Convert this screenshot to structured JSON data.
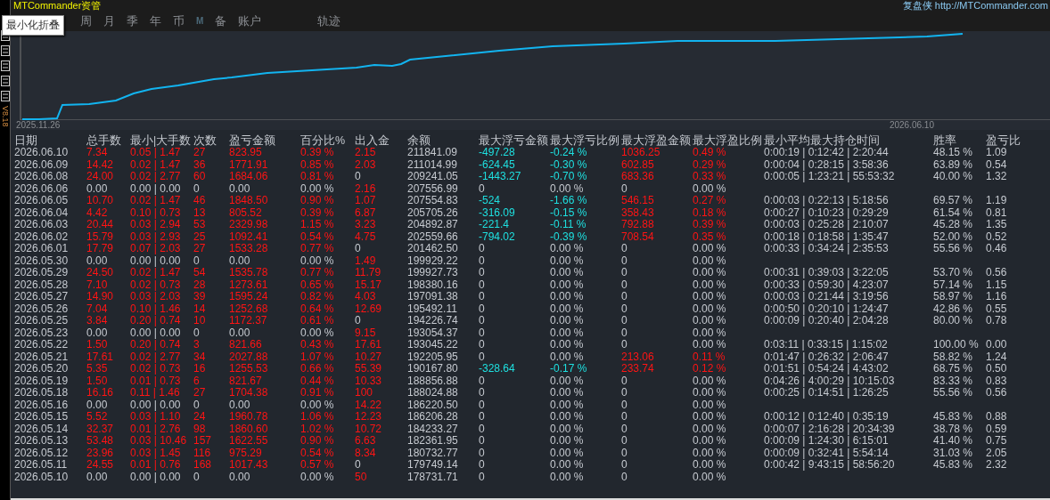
{
  "title": "MTCommander资管",
  "header_link": "复盘侠 http://MTCommander.com",
  "tooltip": "最小化折叠",
  "tabs": [
    "周",
    "月",
    "季",
    "年",
    "币",
    "M",
    "备",
    "账户",
    "轨迹"
  ],
  "version": "V8.18",
  "chart": {
    "start_label": "2025.11.26",
    "end_label": "2026.06.10"
  },
  "table": {
    "columns": [
      "日期",
      "总手数",
      "最小|大手数",
      "次数",
      "盈亏金额",
      "百分比%",
      "出入金",
      "余额",
      "最大浮亏金额",
      "最大浮亏比例",
      "最大浮盈金额",
      "最大浮盈比例",
      "最小平均最大持仓时间",
      "胜率",
      "盈亏比"
    ],
    "rows": [
      {
        "cells": [
          "2026.06.10",
          {
            "text": "7.34",
            "color": "#ff1414"
          },
          {
            "text": "0.05 | 1.47",
            "color": "#ff1414"
          },
          {
            "text": "27",
            "color": "#ff1414"
          },
          {
            "text": "823.95",
            "color": "#ff1414"
          },
          {
            "text": "0.39 %",
            "color": "#ff1414"
          },
          {
            "text": "2.15",
            "color": "#ff1414"
          },
          "211841.09",
          {
            "text": "-497.28",
            "color": "#1ee0e0"
          },
          {
            "text": "-0.24 %",
            "color": "#1ee0e0"
          },
          {
            "text": "1036.25",
            "color": "#ff1414"
          },
          {
            "text": "0.49 %",
            "color": "#ff1414"
          },
          "0:00:19 | 0:12:42 | 2:20:44",
          "48.15 %",
          "1.09"
        ]
      },
      {
        "cells": [
          "2026.06.09",
          {
            "text": "14.42",
            "color": "#ff1414"
          },
          {
            "text": "0.02 | 1.47",
            "color": "#ff1414"
          },
          {
            "text": "36",
            "color": "#ff1414"
          },
          {
            "text": "1771.91",
            "color": "#ff1414"
          },
          {
            "text": "0.85 %",
            "color": "#ff1414"
          },
          {
            "text": "2.03",
            "color": "#ff1414"
          },
          "211014.99",
          {
            "text": "-624.45",
            "color": "#1ee0e0"
          },
          {
            "text": "-0.30 %",
            "color": "#1ee0e0"
          },
          {
            "text": "602.85",
            "color": "#ff1414"
          },
          {
            "text": "0.29 %",
            "color": "#ff1414"
          },
          "0:00:04 | 0:28:15 | 3:58:36",
          "63.89 %",
          "0.54"
        ]
      },
      {
        "cells": [
          "2026.06.08",
          {
            "text": "24.00",
            "color": "#ff1414"
          },
          {
            "text": "0.02 | 2.77",
            "color": "#ff1414"
          },
          {
            "text": "60",
            "color": "#ff1414"
          },
          {
            "text": "1684.06",
            "color": "#ff1414"
          },
          {
            "text": "0.81 %",
            "color": "#ff1414"
          },
          "0",
          "209241.05",
          {
            "text": "-1443.27",
            "color": "#1ee0e0"
          },
          {
            "text": "-0.70 %",
            "color": "#1ee0e0"
          },
          {
            "text": "683.36",
            "color": "#ff1414"
          },
          {
            "text": "0.33 %",
            "color": "#ff1414"
          },
          "0:00:05 | 1:23:21 | 55:53:32",
          "40.00 %",
          "1.32"
        ]
      },
      {
        "cells": [
          "2026.06.06",
          "0.00",
          "0.00 | 0.00",
          "0",
          "0.00",
          "0.00 %",
          {
            "text": "2.16",
            "color": "#ff1414"
          },
          "207556.99",
          "0",
          "0.00 %",
          "0",
          "0.00 %",
          null,
          null,
          null
        ]
      },
      {
        "cells": [
          "2026.06.05",
          {
            "text": "10.70",
            "color": "#ff1414"
          },
          {
            "text": "0.02 | 1.47",
            "color": "#ff1414"
          },
          {
            "text": "46",
            "color": "#ff1414"
          },
          {
            "text": "1848.50",
            "color": "#ff1414"
          },
          {
            "text": "0.90 %",
            "color": "#ff1414"
          },
          {
            "text": "1.07",
            "color": "#ff1414"
          },
          "207554.83",
          {
            "text": "-524",
            "color": "#1ee0e0"
          },
          {
            "text": "-1.66 %",
            "color": "#1ee0e0"
          },
          {
            "text": "546.15",
            "color": "#ff1414"
          },
          {
            "text": "0.27 %",
            "color": "#ff1414"
          },
          "0:00:03 | 0:22:13 | 5:18:56",
          "69.57 %",
          "1.19"
        ]
      },
      {
        "cells": [
          "2026.06.04",
          {
            "text": "4.42",
            "color": "#ff1414"
          },
          {
            "text": "0.10 | 0.73",
            "color": "#ff1414"
          },
          {
            "text": "13",
            "color": "#ff1414"
          },
          {
            "text": "805.52",
            "color": "#ff1414"
          },
          {
            "text": "0.39 %",
            "color": "#ff1414"
          },
          {
            "text": "6.87",
            "color": "#ff1414"
          },
          "205705.26",
          {
            "text": "-316.09",
            "color": "#1ee0e0"
          },
          {
            "text": "-0.15 %",
            "color": "#1ee0e0"
          },
          {
            "text": "358.43",
            "color": "#ff1414"
          },
          {
            "text": "0.18 %",
            "color": "#ff1414"
          },
          "0:00:27 | 0:10:23 | 0:29:29",
          "61.54 %",
          "0.81"
        ]
      },
      {
        "cells": [
          "2026.06.03",
          {
            "text": "20.44",
            "color": "#ff1414"
          },
          {
            "text": "0.03 | 2.94",
            "color": "#ff1414"
          },
          {
            "text": "53",
            "color": "#ff1414"
          },
          {
            "text": "2329.98",
            "color": "#ff1414"
          },
          {
            "text": "1.15 %",
            "color": "#ff1414"
          },
          {
            "text": "3.23",
            "color": "#ff1414"
          },
          "204892.87",
          {
            "text": "-221.4",
            "color": "#1ee0e0"
          },
          {
            "text": "-0.11 %",
            "color": "#1ee0e0"
          },
          {
            "text": "792.88",
            "color": "#ff1414"
          },
          {
            "text": "0.39 %",
            "color": "#ff1414"
          },
          "0:00:03 | 0:25:28 | 2:10:07",
          "45.28 %",
          "1.35"
        ]
      },
      {
        "cells": [
          "2026.06.02",
          {
            "text": "15.79",
            "color": "#ff1414"
          },
          {
            "text": "0.03 | 2.93",
            "color": "#ff1414"
          },
          {
            "text": "25",
            "color": "#ff1414"
          },
          {
            "text": "1092.41",
            "color": "#ff1414"
          },
          {
            "text": "0.54 %",
            "color": "#ff1414"
          },
          {
            "text": "4.75",
            "color": "#ff1414"
          },
          "202559.66",
          {
            "text": "-794.02",
            "color": "#1ee0e0"
          },
          {
            "text": "-0.39 %",
            "color": "#1ee0e0"
          },
          {
            "text": "708.54",
            "color": "#ff1414"
          },
          {
            "text": "0.35 %",
            "color": "#ff1414"
          },
          "0:00:18 | 0:18:58 | 1:35:47",
          "52.00 %",
          "0.52"
        ]
      },
      {
        "cells": [
          "2026.06.01",
          {
            "text": "17.79",
            "color": "#ff1414"
          },
          {
            "text": "0.07 | 2.03",
            "color": "#ff1414"
          },
          {
            "text": "27",
            "color": "#ff1414"
          },
          {
            "text": "1533.28",
            "color": "#ff1414"
          },
          {
            "text": "0.77 %",
            "color": "#ff1414"
          },
          "0",
          "201462.50",
          "0",
          "0.00 %",
          "0",
          "0.00 %",
          "0:00:33 | 0:34:24 | 2:35:53",
          "55.56 %",
          "0.46"
        ]
      },
      {
        "cells": [
          "2026.05.30",
          "0.00",
          "0.00 | 0.00",
          "0",
          "0.00",
          "0.00 %",
          {
            "text": "1.49",
            "color": "#ff1414"
          },
          "199929.22",
          "0",
          "0.00 %",
          "0",
          "0.00 %",
          null,
          null,
          null
        ]
      },
      {
        "cells": [
          "2026.05.29",
          {
            "text": "24.50",
            "color": "#ff1414"
          },
          {
            "text": "0.02 | 1.47",
            "color": "#ff1414"
          },
          {
            "text": "54",
            "color": "#ff1414"
          },
          {
            "text": "1535.78",
            "color": "#ff1414"
          },
          {
            "text": "0.77 %",
            "color": "#ff1414"
          },
          {
            "text": "11.79",
            "color": "#ff1414"
          },
          "199927.73",
          "0",
          "0.00 %",
          "0",
          "0.00 %",
          "0:00:31 | 0:39:03 | 3:22:05",
          "53.70 %",
          "0.56"
        ]
      },
      {
        "cells": [
          "2026.05.28",
          {
            "text": "7.10",
            "color": "#ff1414"
          },
          {
            "text": "0.02 | 0.73",
            "color": "#ff1414"
          },
          {
            "text": "28",
            "color": "#ff1414"
          },
          {
            "text": "1273.61",
            "color": "#ff1414"
          },
          {
            "text": "0.65 %",
            "color": "#ff1414"
          },
          {
            "text": "15.17",
            "color": "#ff1414"
          },
          "198380.16",
          "0",
          "0.00 %",
          "0",
          "0.00 %",
          "0:00:33 | 0:59:30 | 4:23:07",
          "57.14 %",
          "1.15"
        ]
      },
      {
        "cells": [
          "2026.05.27",
          {
            "text": "14.90",
            "color": "#ff1414"
          },
          {
            "text": "0.03 | 2.03",
            "color": "#ff1414"
          },
          {
            "text": "39",
            "color": "#ff1414"
          },
          {
            "text": "1595.24",
            "color": "#ff1414"
          },
          {
            "text": "0.82 %",
            "color": "#ff1414"
          },
          {
            "text": "4.03",
            "color": "#ff1414"
          },
          "197091.38",
          "0",
          "0.00 %",
          "0",
          "0.00 %",
          "0:00:03 | 0:21:44 | 3:19:56",
          "58.97 %",
          "1.16"
        ]
      },
      {
        "cells": [
          "2026.05.26",
          {
            "text": "7.04",
            "color": "#ff1414"
          },
          {
            "text": "0.10 | 1.46",
            "color": "#ff1414"
          },
          {
            "text": "14",
            "color": "#ff1414"
          },
          {
            "text": "1252.68",
            "color": "#ff1414"
          },
          {
            "text": "0.64 %",
            "color": "#ff1414"
          },
          {
            "text": "12.69",
            "color": "#ff1414"
          },
          "195492.11",
          "0",
          "0.00 %",
          "0",
          "0.00 %",
          "0:00:50 | 0:20:10 | 1:24:47",
          "42.86 %",
          "0.55"
        ]
      },
      {
        "cells": [
          "2026.05.25",
          {
            "text": "3.84",
            "color": "#ff1414"
          },
          {
            "text": "0.20 | 0.74",
            "color": "#ff1414"
          },
          {
            "text": "10",
            "color": "#ff1414"
          },
          {
            "text": "1172.37",
            "color": "#ff1414"
          },
          {
            "text": "0.61 %",
            "color": "#ff1414"
          },
          "0",
          "194226.74",
          "0",
          "0.00 %",
          "0",
          "0.00 %",
          "0:00:09 | 0:20:40 | 2:04:28",
          "80.00 %",
          "0.78"
        ]
      },
      {
        "cells": [
          "2026.05.23",
          "0.00",
          "0.00 | 0.00",
          "0",
          "0.00",
          "0.00 %",
          {
            "text": "9.15",
            "color": "#ff1414"
          },
          "193054.37",
          "0",
          "0.00 %",
          "0",
          "0.00 %",
          null,
          null,
          null
        ]
      },
      {
        "cells": [
          "2026.05.22",
          {
            "text": "1.50",
            "color": "#ff1414"
          },
          {
            "text": "0.20 | 0.74",
            "color": "#ff1414"
          },
          {
            "text": "3",
            "color": "#ff1414"
          },
          {
            "text": "821.66",
            "color": "#ff1414"
          },
          {
            "text": "0.43 %",
            "color": "#ff1414"
          },
          {
            "text": "17.61",
            "color": "#ff1414"
          },
          "193045.22",
          "0",
          "0.00 %",
          "0",
          "0.00 %",
          "0:03:11 | 0:33:15 | 1:15:02",
          "100.00 %",
          "0.00"
        ]
      },
      {
        "cells": [
          "2026.05.21",
          {
            "text": "17.61",
            "color": "#ff1414"
          },
          {
            "text": "0.02 | 2.77",
            "color": "#ff1414"
          },
          {
            "text": "34",
            "color": "#ff1414"
          },
          {
            "text": "2027.88",
            "color": "#ff1414"
          },
          {
            "text": "1.07 %",
            "color": "#ff1414"
          },
          {
            "text": "10.27",
            "color": "#ff1414"
          },
          "192205.95",
          "0",
          "0.00 %",
          {
            "text": "213.06",
            "color": "#ff1414"
          },
          {
            "text": "0.11 %",
            "color": "#ff1414"
          },
          "0:01:47 | 0:26:32 | 2:06:47",
          "58.82 %",
          "1.24"
        ]
      },
      {
        "cells": [
          "2026.05.20",
          {
            "text": "5.35",
            "color": "#ff1414"
          },
          {
            "text": "0.02 | 0.73",
            "color": "#ff1414"
          },
          {
            "text": "16",
            "color": "#ff1414"
          },
          {
            "text": "1255.53",
            "color": "#ff1414"
          },
          {
            "text": "0.66 %",
            "color": "#ff1414"
          },
          {
            "text": "55.39",
            "color": "#ff1414"
          },
          "190167.80",
          {
            "text": "-328.64",
            "color": "#1ee0e0"
          },
          {
            "text": "-0.17 %",
            "color": "#1ee0e0"
          },
          {
            "text": "233.74",
            "color": "#ff1414"
          },
          {
            "text": "0.12 %",
            "color": "#ff1414"
          },
          "0:01:51 | 0:54:24 | 4:43:02",
          "68.75 %",
          "0.50"
        ]
      },
      {
        "cells": [
          "2026.05.19",
          {
            "text": "1.50",
            "color": "#ff1414"
          },
          {
            "text": "0.01 | 0.73",
            "color": "#ff1414"
          },
          {
            "text": "6",
            "color": "#ff1414"
          },
          {
            "text": "821.67",
            "color": "#ff1414"
          },
          {
            "text": "0.44 %",
            "color": "#ff1414"
          },
          {
            "text": "10.33",
            "color": "#ff1414"
          },
          "188856.88",
          "0",
          "0.00 %",
          "0",
          "0.00 %",
          "0:04:26 | 4:00:29 | 10:15:03",
          "83.33 %",
          "0.83"
        ]
      },
      {
        "cells": [
          "2026.05.18",
          {
            "text": "16.16",
            "color": "#ff1414"
          },
          {
            "text": "0.11 | 1.46",
            "color": "#ff1414"
          },
          {
            "text": "27",
            "color": "#ff1414"
          },
          {
            "text": "1704.38",
            "color": "#ff1414"
          },
          {
            "text": "0.91 %",
            "color": "#ff1414"
          },
          {
            "text": "100",
            "color": "#ff1414"
          },
          "188024.88",
          "0",
          "0.00 %",
          "0",
          "0.00 %",
          "0:00:25 | 0:14:51 | 1:26:25",
          "55.56 %",
          "0.56"
        ]
      },
      {
        "cells": [
          "2026.05.16",
          "0.00",
          "0.00 | 0.00",
          "0",
          "0.00",
          "0.00 %",
          {
            "text": "14.22",
            "color": "#ff1414"
          },
          "186220.50",
          "0",
          "0.00 %",
          "0",
          "0.00 %",
          null,
          null,
          null
        ]
      },
      {
        "cells": [
          "2026.05.15",
          {
            "text": "5.52",
            "color": "#ff1414"
          },
          {
            "text": "0.03 | 1.10",
            "color": "#ff1414"
          },
          {
            "text": "24",
            "color": "#ff1414"
          },
          {
            "text": "1960.78",
            "color": "#ff1414"
          },
          {
            "text": "1.06 %",
            "color": "#ff1414"
          },
          {
            "text": "12.23",
            "color": "#ff1414"
          },
          "186206.28",
          "0",
          "0.00 %",
          "0",
          "0.00 %",
          "0:00:12 | 0:12:40 | 0:35:19",
          "45.83 %",
          "0.88"
        ]
      },
      {
        "cells": [
          "2026.05.14",
          {
            "text": "32.37",
            "color": "#ff1414"
          },
          {
            "text": "0.01 | 2.76",
            "color": "#ff1414"
          },
          {
            "text": "98",
            "color": "#ff1414"
          },
          {
            "text": "1860.60",
            "color": "#ff1414"
          },
          {
            "text": "1.02 %",
            "color": "#ff1414"
          },
          {
            "text": "10.72",
            "color": "#ff1414"
          },
          "184233.27",
          "0",
          "0.00 %",
          "0",
          "0.00 %",
          "0:00:07 | 2:16:28 | 20:34:39",
          "38.78 %",
          "0.59"
        ]
      },
      {
        "cells": [
          "2026.05.13",
          {
            "text": "53.48",
            "color": "#ff1414"
          },
          {
            "text": "0.03 | 10.46",
            "color": "#ff1414"
          },
          {
            "text": "157",
            "color": "#ff1414"
          },
          {
            "text": "1622.55",
            "color": "#ff1414"
          },
          {
            "text": "0.90 %",
            "color": "#ff1414"
          },
          {
            "text": "6.63",
            "color": "#ff1414"
          },
          "182361.95",
          "0",
          "0.00 %",
          "0",
          "0.00 %",
          "0:00:09 | 1:24:30 | 6:15:01",
          "41.40 %",
          "0.75"
        ]
      },
      {
        "cells": [
          "2026.05.12",
          {
            "text": "23.96",
            "color": "#ff1414"
          },
          {
            "text": "0.03 | 1.45",
            "color": "#ff1414"
          },
          {
            "text": "116",
            "color": "#ff1414"
          },
          {
            "text": "975.29",
            "color": "#ff1414"
          },
          {
            "text": "0.54 %",
            "color": "#ff1414"
          },
          {
            "text": "8.34",
            "color": "#ff1414"
          },
          "180732.77",
          "0",
          "0.00 %",
          "0",
          "0.00 %",
          "0:00:09 | 0:32:41 | 5:54:14",
          "31.03 %",
          "2.05"
        ]
      },
      {
        "cells": [
          "2026.05.11",
          {
            "text": "24.55",
            "color": "#ff1414"
          },
          {
            "text": "0.01 | 0.76",
            "color": "#ff1414"
          },
          {
            "text": "168",
            "color": "#ff1414"
          },
          {
            "text": "1017.43",
            "color": "#ff1414"
          },
          {
            "text": "0.57 %",
            "color": "#ff1414"
          },
          "0",
          "179749.14",
          "0",
          "0.00 %",
          "0",
          "0.00 %",
          "0:00:42 | 9:43:15 | 58:56:20",
          "45.83 %",
          "2.32"
        ]
      },
      {
        "cells": [
          "2026.05.10",
          "0.00",
          "0.00 | 0.00",
          "0",
          "0.00",
          "0.00 %",
          {
            "text": "50",
            "color": "#ff1414"
          },
          "178731.71",
          "0",
          "0.00 %",
          "0",
          "0.00 %",
          null,
          null,
          null
        ]
      }
    ]
  }
}
